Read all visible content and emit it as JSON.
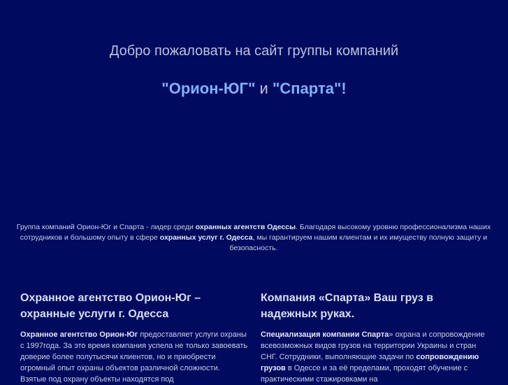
{
  "header": {
    "welcome": "Добро пожаловать на сайт группы компаний",
    "brand_1": "\"Орион-ЮГ\"",
    "conjunction": " и ",
    "brand_2": "\"Спарта\"",
    "brand_end": "!"
  },
  "intro": {
    "t1": "Группа компаний Орион-Юг и Спарта - лидер среди ",
    "b1": "охранных агентств Одессы",
    "t2": ". Благодаря высокому уровню профессионализма наших сотрудников и большому опыту в сфере ",
    "b2": "охранных услуг г. Одесса",
    "t3": ", мы гарантируем нашим клиентам и их имуществу полную защиту и безопасность."
  },
  "left_column": {
    "title": "Охранное агентство Орион-Юг – охранные услуги г. Одесса",
    "b1": "Охранное агентство Орион-Юг",
    "t1": " предоставляет услуги охраны с 1997года. За это время компания успела не только завоевать доверие более полутысячи клиентов, но и приобрести огромный опыт охраны объектов различной сложности. Взятые под охрану объекты находятся под"
  },
  "right_column": {
    "title": "Компания «Спарта» Ваш груз в надежных руках.",
    "b1": "Специализация компании Спарта",
    "t1": "» охрана и сопровождение всевозможных видов грузов на территории Украины и стран СНГ. Сотрудники, выполняющие задачи по ",
    "b2": "сопровождению грузов",
    "t2": " в Одессе и за её пределами, проходят обучение с практическими стажировками на"
  }
}
